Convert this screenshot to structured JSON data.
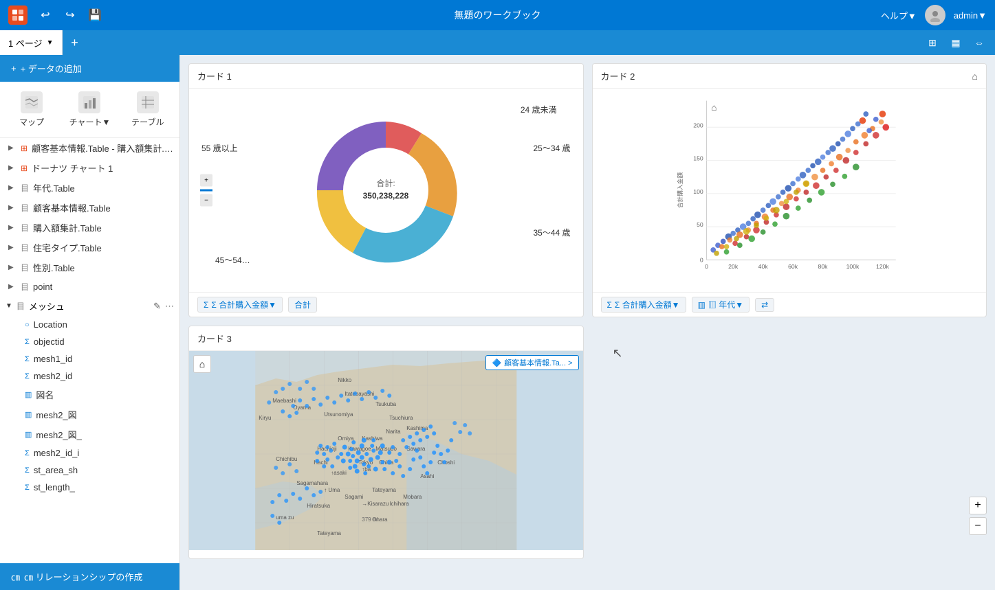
{
  "app": {
    "logo": "A",
    "title": "無題のワークブック",
    "help": "ヘルプ▼",
    "username": "admin▼"
  },
  "tabbar": {
    "current_tab": "1 ページ",
    "add_tab_label": "+",
    "icons": [
      "grid-icon",
      "layout-icon",
      "split-icon"
    ]
  },
  "sidebar": {
    "add_data_label": "+ データの追加",
    "tools": [
      {
        "id": "map",
        "label": "マップ"
      },
      {
        "id": "chart",
        "label": "チャート▼"
      },
      {
        "id": "table",
        "label": "テーブル"
      }
    ],
    "data_items": [
      {
        "id": "item1",
        "type": "expand",
        "icon": "▶",
        "label": "顧客基本情報.Table - 購入額集計.Ta...",
        "color": "#e84b1e"
      },
      {
        "id": "item2",
        "type": "expand",
        "icon": "▶",
        "label": "ドーナツ チャート 1",
        "color": "#e84b1e"
      },
      {
        "id": "item3",
        "type": "expand",
        "icon": "▶",
        "label": "年代.Table"
      },
      {
        "id": "item4",
        "type": "expand",
        "icon": "▶",
        "label": "顧客基本情報.Table"
      },
      {
        "id": "item5",
        "type": "expand",
        "icon": "▶",
        "label": "購入額集計.Table"
      },
      {
        "id": "item6",
        "type": "expand",
        "icon": "▶",
        "label": "住宅タイプ.Table"
      },
      {
        "id": "item7",
        "type": "expand",
        "icon": "▶",
        "label": "性別.Table"
      },
      {
        "id": "item8",
        "type": "expand",
        "icon": "▶",
        "label": "point"
      }
    ],
    "mesh_section": {
      "label": "メッシュ",
      "expanded": true,
      "icon": "▼",
      "sub_items": [
        {
          "id": "loc",
          "label": "Location",
          "icon": "○",
          "color": "#0078d4"
        },
        {
          "id": "oid",
          "label": "objectid",
          "icon": "Σ",
          "color": "#0078d4"
        },
        {
          "id": "m1",
          "label": "mesh1_id",
          "icon": "Σ",
          "color": "#0078d4"
        },
        {
          "id": "m2",
          "label": "mesh2_id",
          "icon": "Σ",
          "color": "#0078d4"
        },
        {
          "id": "zu",
          "label": "図名",
          "icon": "▥",
          "color": "#0078d4"
        },
        {
          "id": "m2zu",
          "label": "mesh2_図",
          "icon": "▥",
          "color": "#0078d4"
        },
        {
          "id": "m2zu_",
          "label": "mesh2_図_",
          "icon": "▥",
          "color": "#0078d4"
        },
        {
          "id": "m2id",
          "label": "mesh2_id_i",
          "icon": "Σ",
          "color": "#0078d4"
        },
        {
          "id": "sta",
          "label": "st_area_sh",
          "icon": "Σ",
          "color": "#0078d4"
        },
        {
          "id": "stl",
          "label": "st_length_",
          "icon": "Σ",
          "color": "#0078d4"
        }
      ]
    },
    "relation_label": "㎝ リレーションシップの作成"
  },
  "cards": {
    "card1": {
      "title": "カード 1",
      "donut": {
        "total_label": "合計:",
        "total_value": "350,238,228",
        "segments": [
          {
            "label": "24 歳未満",
            "value": 15,
            "color": "#e05c5c",
            "angle_start": 0,
            "angle_end": 54
          },
          {
            "label": "25〜34 歳",
            "value": 20,
            "color": "#e8a040",
            "angle_start": 54,
            "angle_end": 126
          },
          {
            "label": "35〜44 歳",
            "value": 22,
            "color": "#4ab0d4",
            "angle_start": 126,
            "angle_end": 205
          },
          {
            "label": "45〜54…",
            "value": 18,
            "color": "#f0c040",
            "angle_start": 205,
            "angle_end": 270
          },
          {
            "label": "55 歳以上",
            "value": 25,
            "color": "#8060c0",
            "angle_start": 270,
            "angle_end": 360
          }
        ]
      },
      "footer_badge1": "Σ 合計購入金額▼",
      "footer_badge2": "合計"
    },
    "card2": {
      "title": "カード 2",
      "scatter": {
        "x_label": "合計購入金額",
        "y_label": "合計購入金額",
        "x_ticks": [
          "0",
          "20k",
          "40k",
          "60k",
          "80k",
          "100k",
          "120k"
        ],
        "y_ticks": [
          "0",
          "50",
          "100",
          "150",
          "200"
        ],
        "footer_badge1": "Σ 合計購入金額▼",
        "footer_badge2": "▥ 年代▼",
        "footer_icon": "⟺"
      }
    },
    "card3": {
      "title": "カード 3",
      "map": {
        "layer_label": "顧客基本情報.Ta... >",
        "has_dots": true
      }
    }
  }
}
